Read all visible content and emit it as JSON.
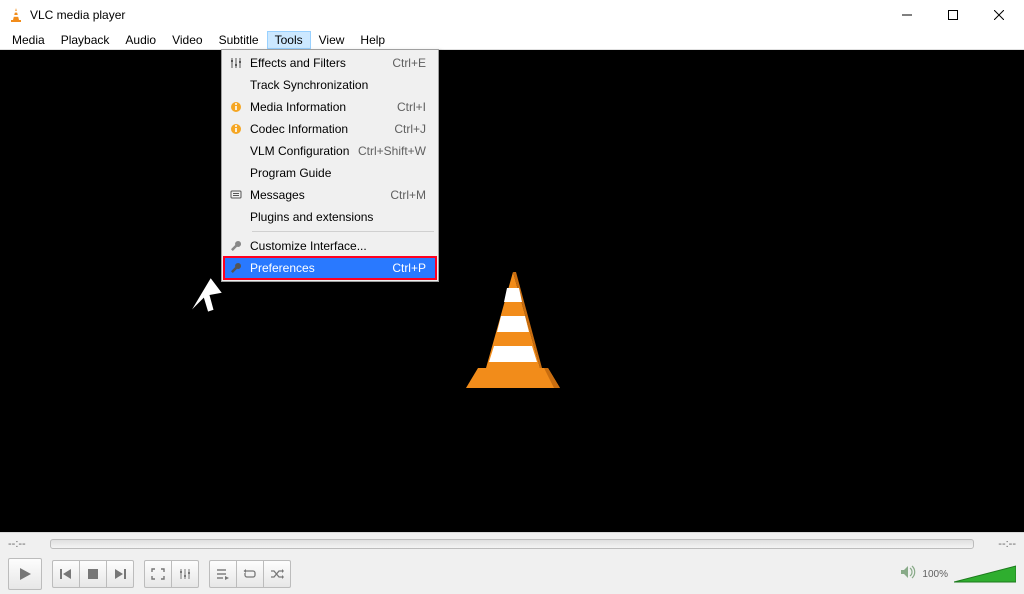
{
  "window": {
    "title": "VLC media player"
  },
  "menubar": {
    "items": [
      "Media",
      "Playback",
      "Audio",
      "Video",
      "Subtitle",
      "Tools",
      "View",
      "Help"
    ],
    "active_index": 5
  },
  "tools_menu": {
    "items": [
      {
        "icon": "sliders",
        "label": "Effects and Filters",
        "shortcut": "Ctrl+E"
      },
      {
        "icon": "",
        "label": "Track Synchronization",
        "shortcut": ""
      },
      {
        "icon": "info",
        "label": "Media Information",
        "shortcut": "Ctrl+I"
      },
      {
        "icon": "info",
        "label": "Codec Information",
        "shortcut": "Ctrl+J"
      },
      {
        "icon": "",
        "label": "VLM Configuration",
        "shortcut": "Ctrl+Shift+W"
      },
      {
        "icon": "",
        "label": "Program Guide",
        "shortcut": ""
      },
      {
        "icon": "message",
        "label": "Messages",
        "shortcut": "Ctrl+M"
      },
      {
        "icon": "",
        "label": "Plugins and extensions",
        "shortcut": ""
      },
      {
        "separator": true
      },
      {
        "icon": "wrench",
        "label": "Customize Interface...",
        "shortcut": ""
      },
      {
        "icon": "wrench",
        "label": "Preferences",
        "shortcut": "Ctrl+P",
        "highlighted": true
      }
    ]
  },
  "seek": {
    "elapsed": "--:--",
    "remaining": "--:--"
  },
  "controls": {
    "volume_label": "100%"
  }
}
